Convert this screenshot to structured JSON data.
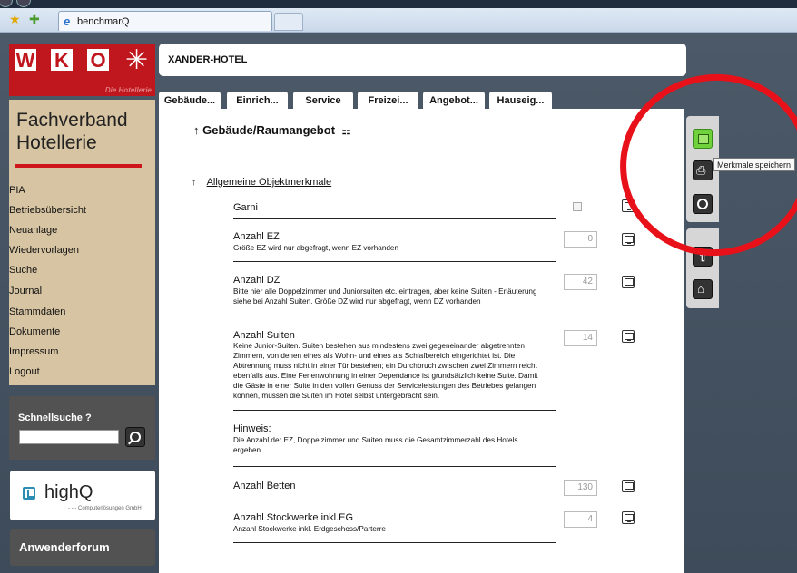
{
  "browser": {
    "tab_title": "benchmarQ"
  },
  "sidebar": {
    "logo_letters": [
      "W",
      "K",
      "O"
    ],
    "logo_subtitle": "Die Hotellerie",
    "org_title": "Fachverband Hotellerie",
    "nav": [
      "PIA",
      "Betriebsübersicht",
      "Neuanlage",
      "Wiedervorlagen",
      "Suche",
      "Journal",
      "Stammdaten",
      "Dokumente",
      "Impressum",
      "Logout"
    ],
    "quicksearch_label": "Schnellsuche ?",
    "quicksearch_value": "",
    "highq_name": "highQ",
    "highq_claim": "- - - Computerlösungen GmbH",
    "forum_label": "Anwenderforum"
  },
  "header": {
    "hotel_name": "XANDER-HOTEL"
  },
  "tabs": [
    "Gebäude...",
    "Einrich...",
    "Service",
    "Freizei...",
    "Angebot...",
    "Hauseig..."
  ],
  "content": {
    "section_title": "↑ Gebäude/Raumangebot",
    "group_arrow": "↑",
    "group_title": "Allgemeine Objektmerkmale",
    "rows": [
      {
        "title": "Garni",
        "desc": "",
        "value": ""
      },
      {
        "title": "Anzahl EZ",
        "desc": "Größe EZ wird nur abgefragt, wenn EZ vorhanden",
        "value": "0"
      },
      {
        "title": "Anzahl DZ",
        "desc": "Bitte hier alle Doppelzimmer und Juniorsuiten etc. eintragen, aber keine Suiten - Erläuterung siehe bei Anzahl Suiten. Größe DZ wird nur abgefragt, wenn DZ vorhanden",
        "value": "42"
      },
      {
        "title": "Anzahl Suiten",
        "desc": "Keine Junior-Suiten. Suiten bestehen aus mindestens zwei gegeneinander abgetrennten Zimmern, von denen eines als Wohn- und eines als Schlafbereich eingerichtet ist. Die Abtrennung muss nicht in einer Tür bestehen; ein Durchbruch zwischen zwei Zimmern reicht ebenfalls aus. Eine Ferienwohnung in einer Dependance ist grundsätzlich keine Suite. Damit die Gäste in einer Suite in den vollen Genuss der Serviceleistungen des Betriebes gelangen können, müssen die Suiten im Hotel selbst untergebracht sein.",
        "value": "14"
      },
      {
        "title": "Hinweis:",
        "desc": "Die Anzahl der EZ, Doppelzimmer und Suiten muss die Gesamtzimmerzahl des Hotels ergeben",
        "value": ""
      },
      {
        "title": "Anzahl Betten",
        "desc": "",
        "value": "130"
      },
      {
        "title": "Anzahl Stockwerke inkl.EG",
        "desc": "Anzahl Stockwerke inkl. Erdgeschoss/Parterre",
        "value": "4"
      }
    ]
  },
  "toolbar": {
    "tooltip": "Merkmale speichern"
  },
  "colors": {
    "brand_red": "#c0161d",
    "sidebar_tan": "#d7c4a2",
    "save_green": "#6fd13b",
    "annotation_red": "#e8111a"
  }
}
